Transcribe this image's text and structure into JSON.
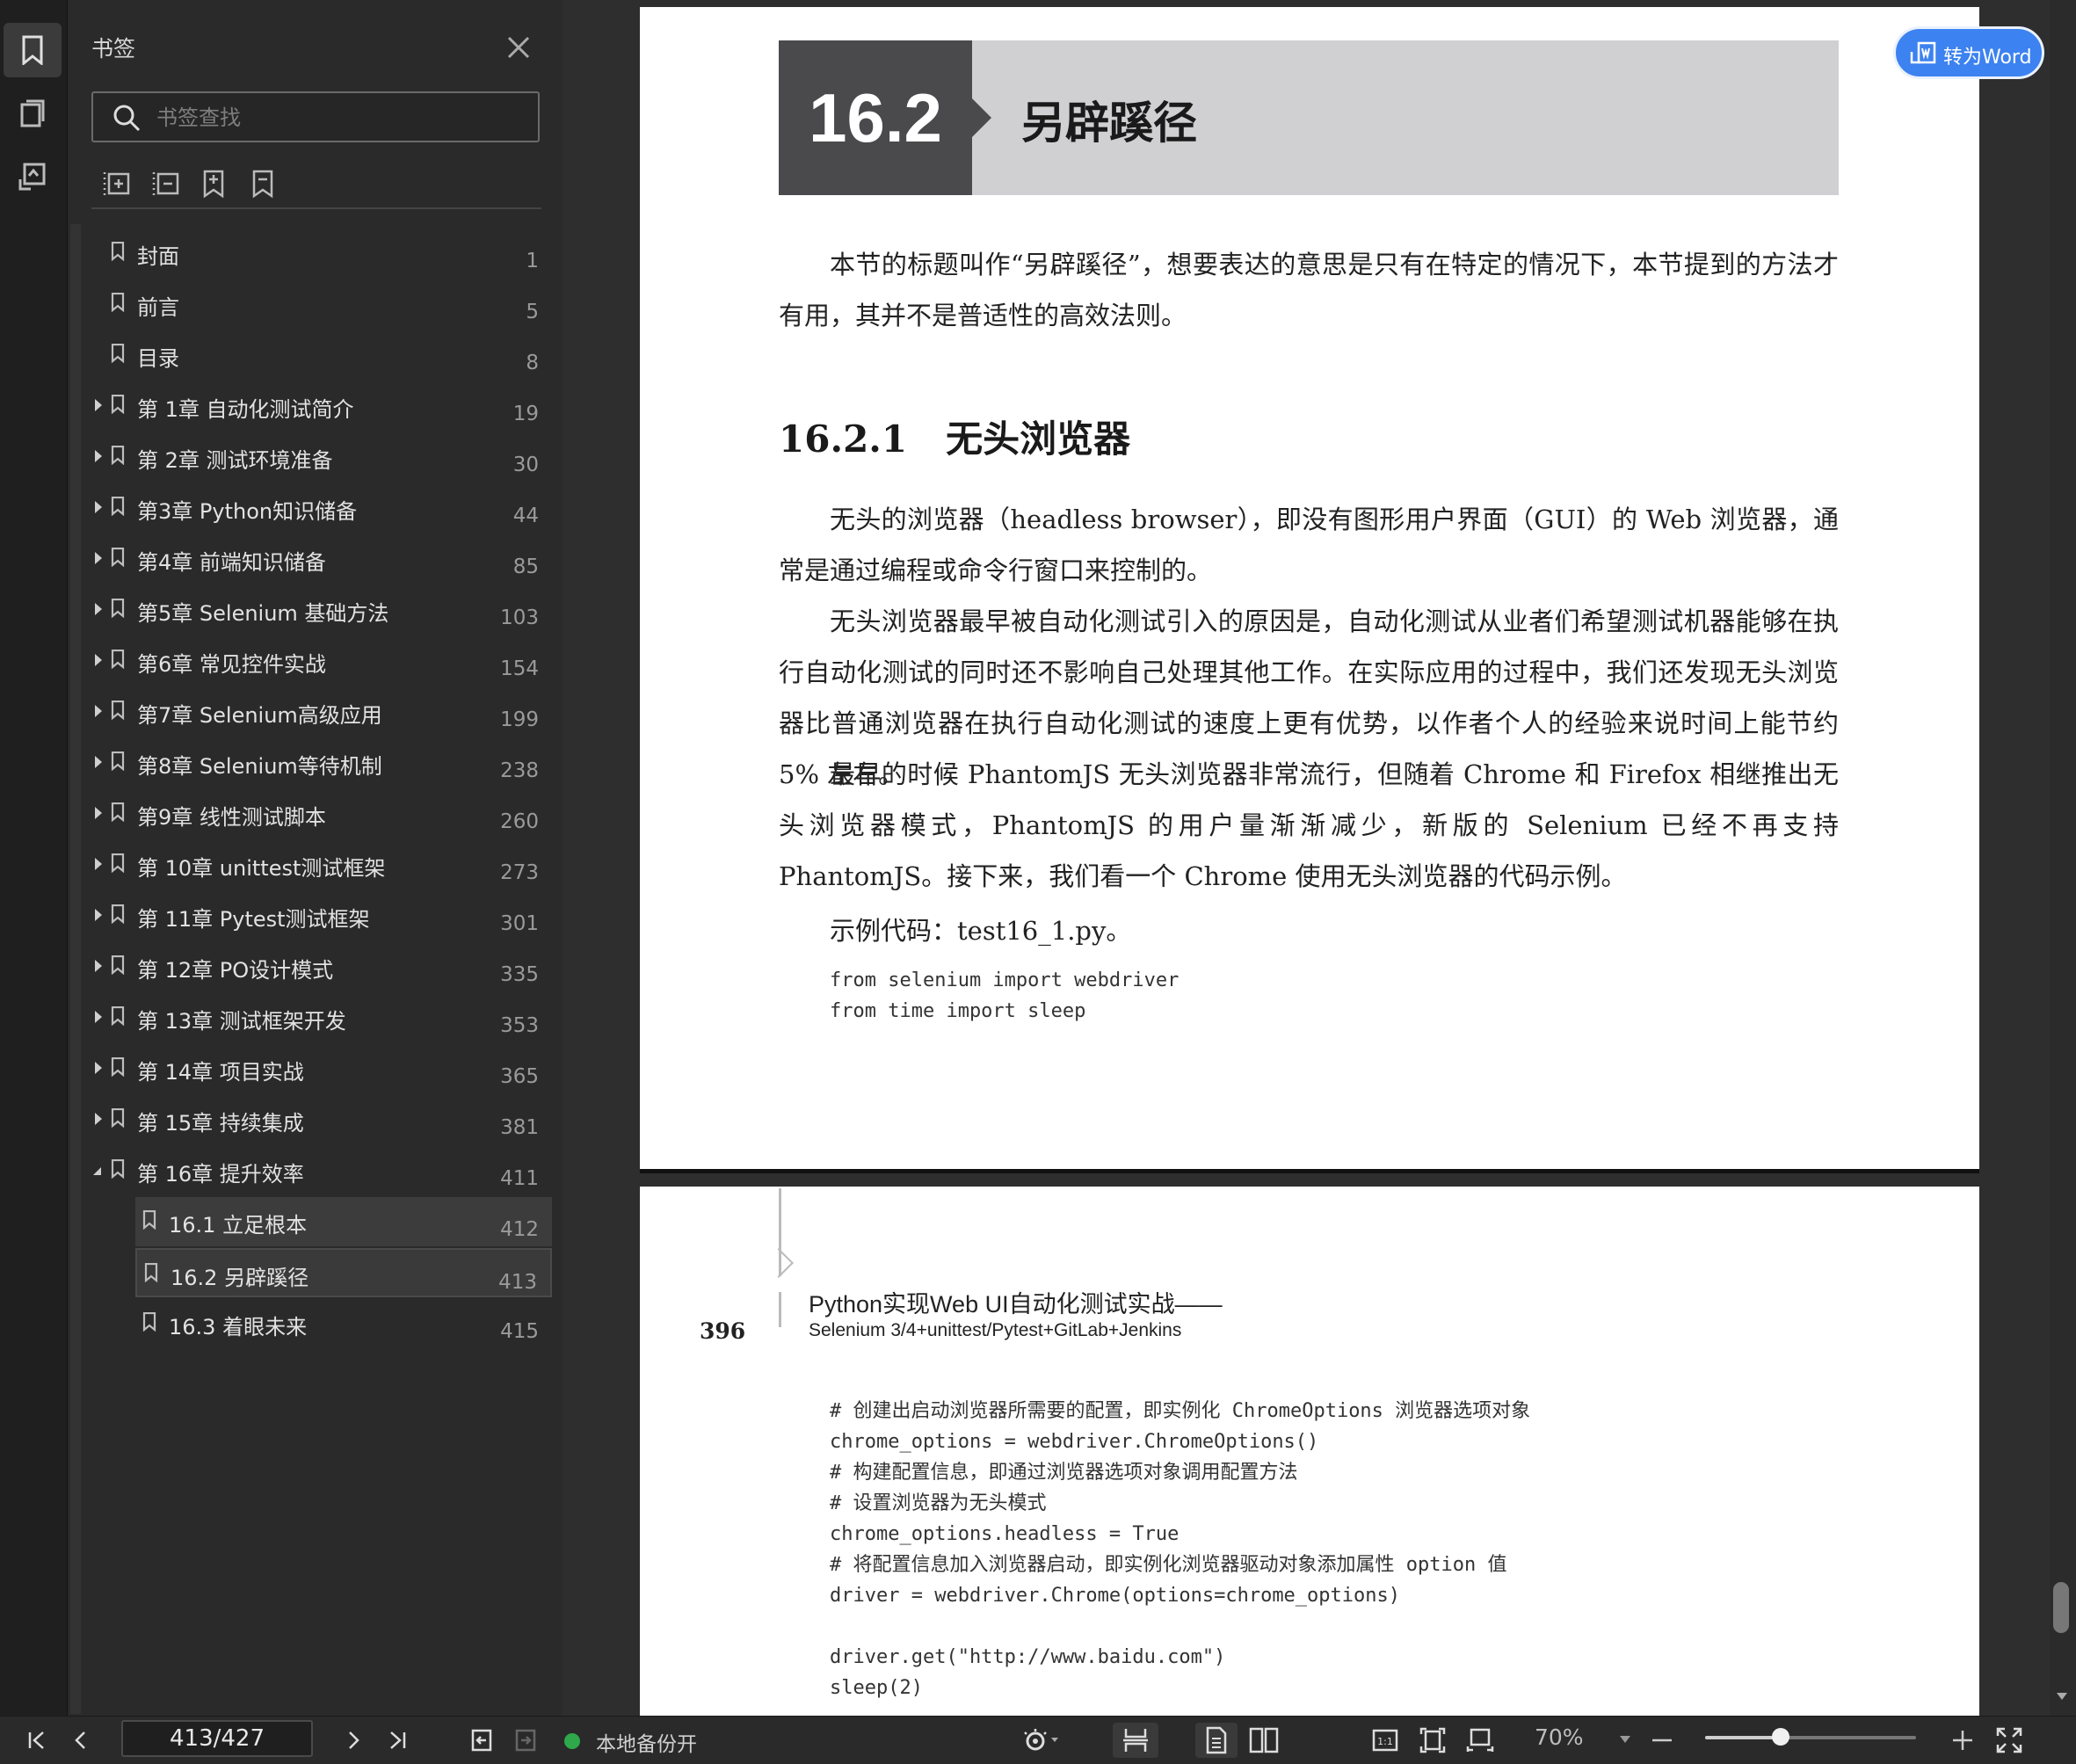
{
  "sidebar": {
    "title": "书签",
    "search_placeholder": "书签查找",
    "bookmarks": [
      {
        "label": "封面",
        "page": "1",
        "level": 0,
        "expandable": false
      },
      {
        "label": "前言",
        "page": "5",
        "level": 0,
        "expandable": false
      },
      {
        "label": "目录",
        "page": "8",
        "level": 0,
        "expandable": false
      },
      {
        "label": "第 1章 自动化测试简介",
        "page": "19",
        "level": 0,
        "expandable": true
      },
      {
        "label": "第 2章 测试环境准备",
        "page": "30",
        "level": 0,
        "expandable": true
      },
      {
        "label": "第3章 Python知识储备",
        "page": "44",
        "level": 0,
        "expandable": true
      },
      {
        "label": "第4章 前端知识储备",
        "page": "85",
        "level": 0,
        "expandable": true
      },
      {
        "label": "第5章 Selenium 基础方法",
        "page": "103",
        "level": 0,
        "expandable": true
      },
      {
        "label": "第6章 常见控件实战",
        "page": "154",
        "level": 0,
        "expandable": true
      },
      {
        "label": "第7章 Selenium高级应用",
        "page": "199",
        "level": 0,
        "expandable": true
      },
      {
        "label": "第8章 Selenium等待机制",
        "page": "238",
        "level": 0,
        "expandable": true
      },
      {
        "label": "第9章 线性测试脚本",
        "page": "260",
        "level": 0,
        "expandable": true
      },
      {
        "label": "第 10章 unittest测试框架",
        "page": "273",
        "level": 0,
        "expandable": true
      },
      {
        "label": "第 11章 Pytest测试框架",
        "page": "301",
        "level": 0,
        "expandable": true
      },
      {
        "label": "第 12章 PO设计模式",
        "page": "335",
        "level": 0,
        "expandable": true
      },
      {
        "label": "第 13章 测试框架开发",
        "page": "353",
        "level": 0,
        "expandable": true
      },
      {
        "label": "第 14章 项目实战",
        "page": "365",
        "level": 0,
        "expandable": true
      },
      {
        "label": "第 15章 持续集成",
        "page": "381",
        "level": 0,
        "expandable": true
      },
      {
        "label": "第 16章 提升效率",
        "page": "411",
        "level": 0,
        "expandable": true,
        "expanded": true
      },
      {
        "label": "16.1 立足根本",
        "page": "412",
        "level": 1,
        "expandable": false,
        "state": "selected"
      },
      {
        "label": "16.2 另辟蹊径",
        "page": "413",
        "level": 1,
        "expandable": false,
        "state": "current"
      },
      {
        "label": "16.3 着眼未来",
        "page": "415",
        "level": 1,
        "expandable": false
      }
    ]
  },
  "to_word_label": "转为Word",
  "document": {
    "chapter_number": "16.2",
    "chapter_title": "另辟蹊径",
    "intro": "本节的标题叫作“另辟蹊径”，想要表达的意思是只有在特定的情况下，本节提到的方法才有用，其并不是普适性的高效法则。",
    "section_number": "16.2.1",
    "section_title": "无头浏览器",
    "para1": "无头的浏览器（headless browser），即没有图形用户界面（GUI）的 Web 浏览器，通常是通过编程或命令行窗口来控制的。",
    "para2": "无头浏览器最早被自动化测试引入的原因是，自动化测试从业者们希望测试机器能够在执行自动化测试的同时还不影响自己处理其他工作。在实际应用的过程中，我们还发现无头浏览器比普通浏览器在执行自动化测试的速度上更有优势，以作者个人的经验来说时间上能节约 5% 左右。",
    "para3": "最早的时候 PhantomJS 无头浏览器非常流行，但随着 Chrome 和 Firefox 相继推出无头浏览器模式，PhantomJS 的用户量渐渐减少，新版的 Selenium 已经不再支持 PhantomJS。接下来，我们看一个 Chrome 使用无头浏览器的代码示例。",
    "example_label": "示例代码：test16_1.py。",
    "code_top": [
      "from selenium import webdriver",
      "from time import sleep"
    ],
    "page2_header_title": "Python实现Web UI自动化测试实战——",
    "page2_header_subtitle": "Selenium 3/4+unittest/Pytest+GitLab+Jenkins",
    "page2_number": "396",
    "code_bottom": [
      "# 创建出启动浏览器所需要的配置，即实例化 ChromeOptions 浏览器选项对象",
      "chrome_options = webdriver.ChromeOptions()",
      "# 构建配置信息，即通过浏览器选项对象调用配置方法",
      "# 设置浏览器为无头模式",
      "chrome_options.headless = True",
      "# 将配置信息加入浏览器启动，即实例化浏览器驱动对象添加属性 option 值",
      "driver = webdriver.Chrome(options=chrome_options)",
      "",
      "driver.get(\"http://www.baidu.com\")",
      "sleep(2)"
    ]
  },
  "status": {
    "page_indicator": "413/427",
    "backup_label": "本地备份开",
    "zoom": "70%",
    "zoom_level": 0.36
  },
  "colors": {
    "accent": "#3c82f0",
    "backup_on": "#2ea84a"
  }
}
